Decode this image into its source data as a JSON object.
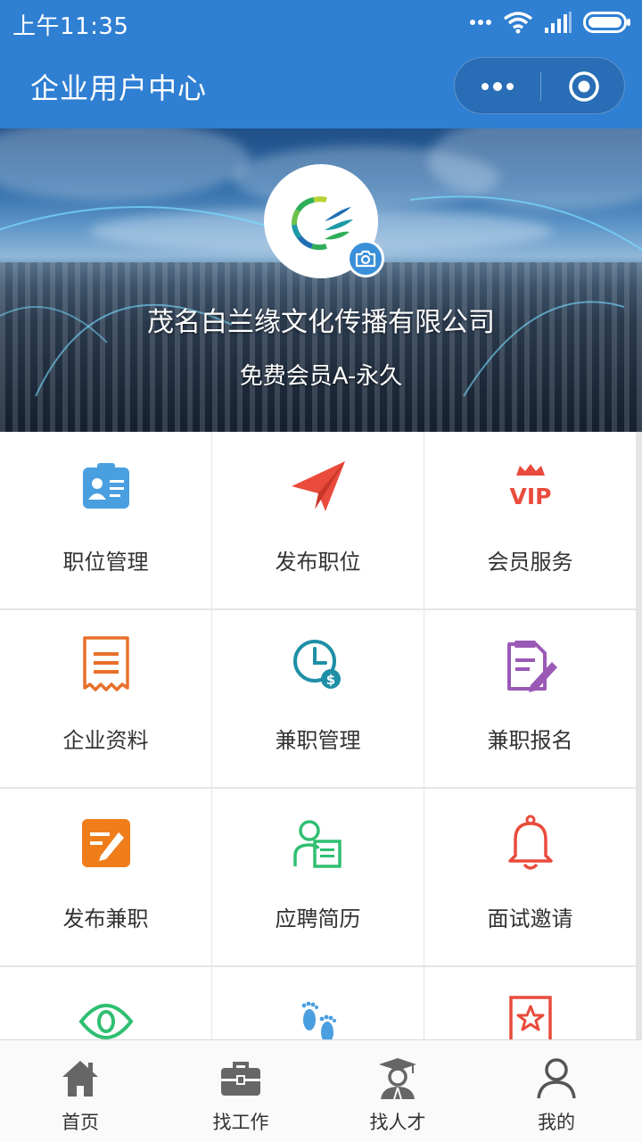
{
  "status": {
    "time": "上午11:35"
  },
  "nav": {
    "title": "企业用户中心",
    "more_icon": "more-dots-icon",
    "close_icon": "target-close-icon"
  },
  "profile": {
    "company": "茂名白兰缘文化传播有限公司",
    "membership": "免费会员A-永久"
  },
  "menu": [
    {
      "label": "职位管理",
      "icon": "id-card-icon",
      "color": "#4a9fe0"
    },
    {
      "label": "发布职位",
      "icon": "paper-plane-icon",
      "color": "#e94b3c"
    },
    {
      "label": "会员服务",
      "icon": "vip-crown-icon",
      "color": "#e94b3c"
    },
    {
      "label": "企业资料",
      "icon": "receipt-icon",
      "color": "#e8702a"
    },
    {
      "label": "兼职管理",
      "icon": "clock-coin-icon",
      "color": "#1f8fa6"
    },
    {
      "label": "兼职报名",
      "icon": "document-pen-icon",
      "color": "#9b59b6"
    },
    {
      "label": "发布兼职",
      "icon": "edit-note-icon",
      "color": "#ef7d1a"
    },
    {
      "label": "应聘简历",
      "icon": "person-resume-icon",
      "color": "#2fbf71"
    },
    {
      "label": "面试邀请",
      "icon": "bell-icon",
      "color": "#e94b3c"
    },
    {
      "label": "",
      "icon": "eye-icon",
      "color": "#2fbf71"
    },
    {
      "label": "",
      "icon": "footprints-icon",
      "color": "#4a9fe0"
    },
    {
      "label": "",
      "icon": "star-badge-icon",
      "color": "#e94b3c"
    }
  ],
  "tabs": [
    {
      "label": "首页",
      "icon": "home-icon"
    },
    {
      "label": "找工作",
      "icon": "briefcase-icon"
    },
    {
      "label": "找人才",
      "icon": "graduate-icon"
    },
    {
      "label": "我的",
      "icon": "user-icon"
    }
  ]
}
